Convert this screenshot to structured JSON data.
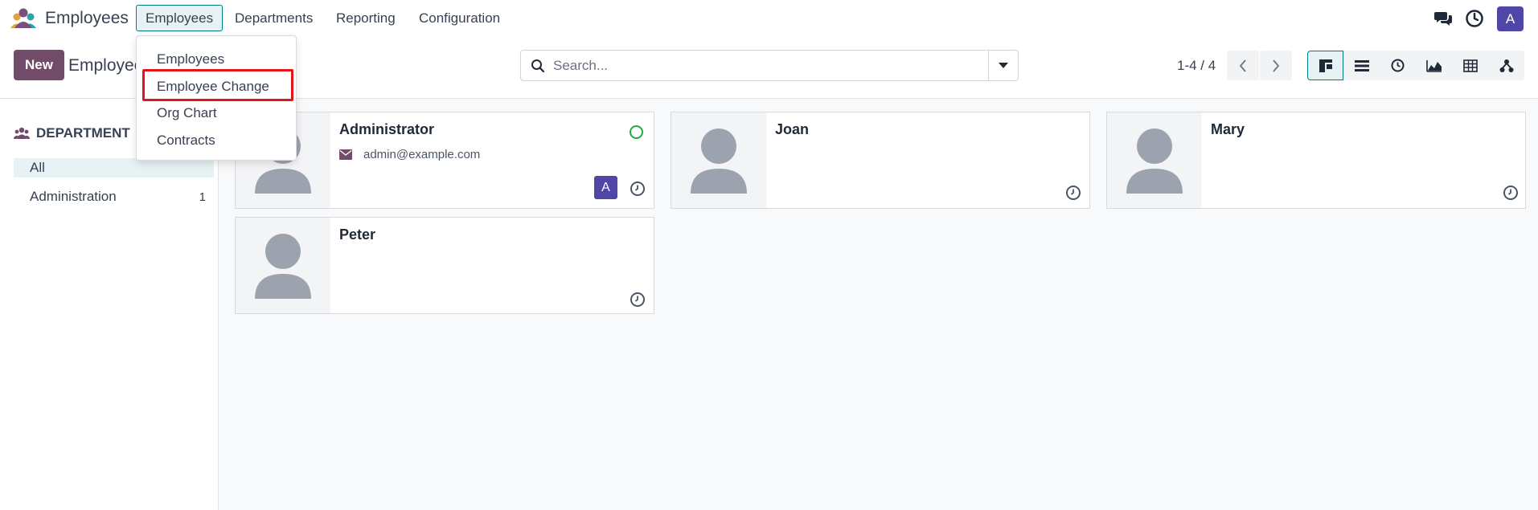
{
  "navbar": {
    "app_name": "Employees",
    "menu": [
      "Employees",
      "Departments",
      "Reporting",
      "Configuration"
    ],
    "user_initial": "A"
  },
  "dropdown": {
    "items": [
      "Employees",
      "Employee Change",
      "Org Chart",
      "Contracts"
    ],
    "highlighted": "Employee Change"
  },
  "control_panel": {
    "new_label": "New",
    "breadcrumb": "Employees",
    "search_placeholder": "Search...",
    "pager": "1-4 / 4",
    "views": [
      "kanban",
      "list",
      "activity",
      "graph",
      "pivot",
      "hierarchy"
    ],
    "active_view": "kanban"
  },
  "sidebar": {
    "header": "DEPARTMENT",
    "items": [
      {
        "label": "All",
        "count": ""
      },
      {
        "label": "Administration",
        "count": "1"
      }
    ]
  },
  "cards": [
    {
      "name": "Administrator",
      "email": "admin@example.com",
      "avatar": "A",
      "online": true
    },
    {
      "name": "Joan"
    },
    {
      "name": "Mary"
    },
    {
      "name": "Peter"
    }
  ],
  "colors": {
    "brand": "#714b67",
    "teal": "#017e84",
    "avatar": "#4f46a6",
    "highlight": "#e3151a"
  }
}
